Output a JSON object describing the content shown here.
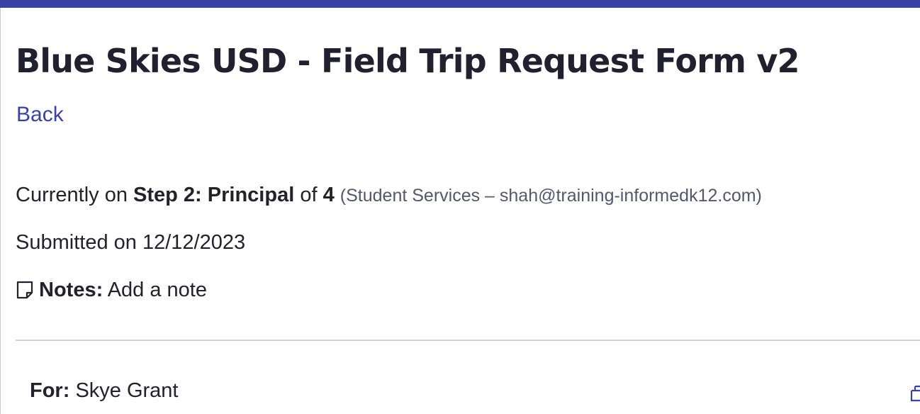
{
  "header": {
    "title": "Blue Skies USD - Field Trip Request Form v2",
    "back_label": "Back"
  },
  "status": {
    "prefix": "Currently on",
    "step_label": "Step 2: Principal",
    "of_label": "of",
    "total_steps": "4",
    "detail": "(Student Services – shah@training-informedk12.com)",
    "submitted": "Submitted on 12/12/2023"
  },
  "notes": {
    "icon": "sticky-note-icon",
    "label": "Notes:",
    "action": "Add a note"
  },
  "recipient": {
    "label": "For:",
    "name": "Skye Grant",
    "icon": "print-icon"
  },
  "colors": {
    "accent": "#3a42a3",
    "text": "#22222a",
    "muted": "#55586a"
  }
}
